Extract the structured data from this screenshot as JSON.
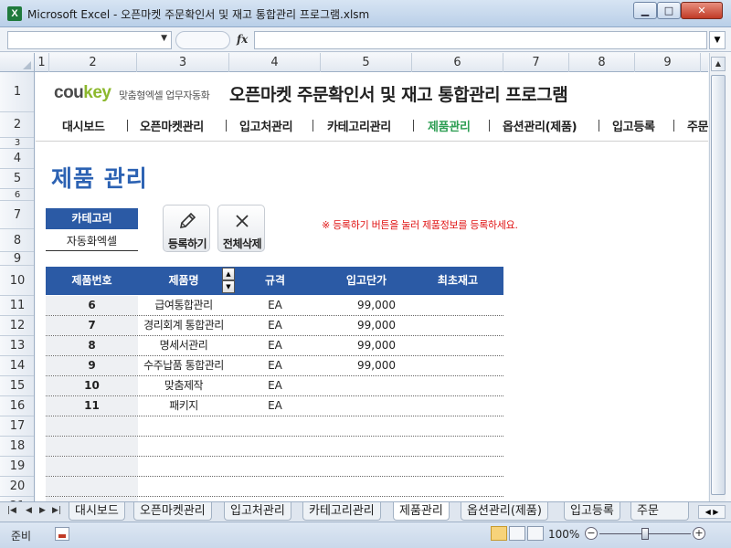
{
  "window": {
    "title": "Microsoft Excel - 오픈마켓 주문확인서 및 재고 통합관리 프로그램.xlsm",
    "icon": "excel-icon",
    "controls": {
      "minimize": "▁",
      "maximize": "□",
      "close": "✕"
    }
  },
  "formula_bar": {
    "namebox_value": "",
    "fx_label": "fx",
    "formula_value": ""
  },
  "columns": [
    "1",
    "2",
    "3",
    "4",
    "5",
    "6",
    "7",
    "8",
    "9"
  ],
  "rows": [
    "1",
    "2",
    "3",
    "4",
    "5",
    "6",
    "7",
    "8",
    "9",
    "10",
    "11",
    "12",
    "13",
    "14",
    "15",
    "16",
    "17",
    "18",
    "19",
    "20",
    "21"
  ],
  "header": {
    "logo_main": "cou",
    "logo_accent": "key",
    "logo_sub": "맞춤형엑셀 업무자동화",
    "app_title": "오픈마켓 주문확인서 및 재고 통합관리 프로그램"
  },
  "nav": {
    "items": [
      "대시보드",
      "오픈마켓관리",
      "입고처관리",
      "카테고리관리",
      "제품관리",
      "옵션관리(제품)",
      "입고등록",
      "주문"
    ],
    "active_index": 4
  },
  "page_title": "제품 관리",
  "category": {
    "label": "카테고리",
    "value": "자동화엑셀"
  },
  "buttons": {
    "register": "등록하기",
    "delete_all": "전체삭제"
  },
  "notice": "※ 등록하기 버튼을 눌러 제품정보를 등록하세요.",
  "table": {
    "headers": [
      "제품번호",
      "제품명",
      "규격",
      "입고단가",
      "최초재고"
    ],
    "spin_up": "▲",
    "spin_down": "▼",
    "rows": [
      {
        "id": "6",
        "name": "급여통합관리",
        "unit": "EA",
        "price": "99,000",
        "stock": ""
      },
      {
        "id": "7",
        "name": "경리회계 통합관리",
        "unit": "EA",
        "price": "99,000",
        "stock": ""
      },
      {
        "id": "8",
        "name": "명세서관리",
        "unit": "EA",
        "price": "99,000",
        "stock": ""
      },
      {
        "id": "9",
        "name": "수주납품 통합관리",
        "unit": "EA",
        "price": "99,000",
        "stock": ""
      },
      {
        "id": "10",
        "name": "맞춤제작",
        "unit": "EA",
        "price": "",
        "stock": ""
      },
      {
        "id": "11",
        "name": "패키지",
        "unit": "EA",
        "price": "",
        "stock": ""
      }
    ]
  },
  "sheet_tabs": {
    "tabs": [
      "대시보드",
      "오픈마켓관리",
      "입고처관리",
      "카테고리관리",
      "제품관리",
      "옵션관리(제품)",
      "입고등록",
      "주문"
    ],
    "active_index": 4
  },
  "status": {
    "ready": "준비",
    "zoom": "100%",
    "zoom_minus": "−",
    "zoom_plus": "+"
  },
  "colors": {
    "accent_blue": "#2b5aa5",
    "title_blue": "#2c62b3",
    "active_nav_green": "#2e9e54",
    "notice_red": "#e01414",
    "logo_green": "#8cb82d"
  }
}
